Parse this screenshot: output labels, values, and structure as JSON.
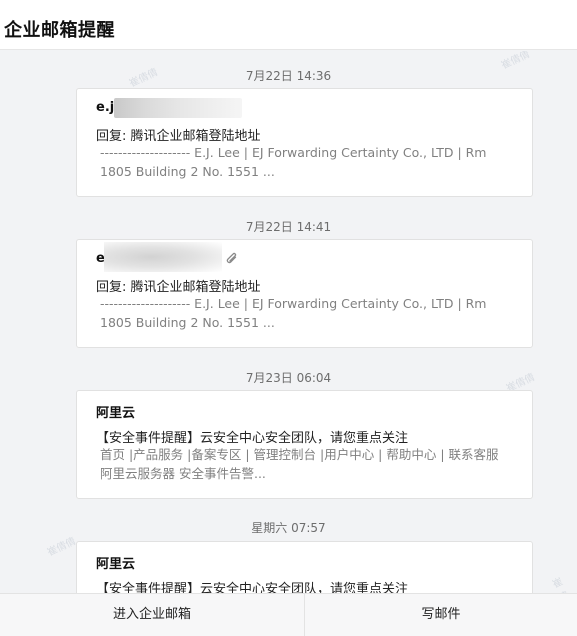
{
  "header": {
    "title": "企业邮箱提醒"
  },
  "messages": [
    {
      "time": "7月22日 14:36",
      "sender": "e.j.",
      "subject": "回复: 腾讯企业邮箱登陆地址",
      "preview_line1": "-------------------- E.J. Lee | EJ Forwarding Certainty Co., LTD | Rm",
      "preview_line2": "1805 Building 2 No. 1551 ...",
      "has_attachment": false
    },
    {
      "time": "7月22日 14:41",
      "sender": "e",
      "subject": "回复: 腾讯企业邮箱登陆地址",
      "preview_line1": "-------------------- E.J. Lee | EJ Forwarding Certainty Co., LTD | Rm",
      "preview_line2": "1805 Building 2 No. 1551 ...",
      "has_attachment": true
    },
    {
      "time": "7月23日 06:04",
      "sender": "阿里云",
      "subject": "【安全事件提醒】云安全中心安全团队，请您重点关注",
      "preview_line1": "首页 |产品服务 |备案专区 | 管理控制台 |用户中心 | 帮助中心 | 联系客服",
      "preview_line2": "阿里云服务器 安全事件告警...",
      "has_attachment": false
    },
    {
      "time": "星期六 07:57",
      "sender": "阿里云",
      "subject": "【安全事件提醒】云安全中心安全团队，请您重点关注",
      "preview_line1": "",
      "preview_line2": "",
      "has_attachment": false
    }
  ],
  "watermark_text": "崔倩倩",
  "footer": {
    "enter_mailbox_label": "进入企业邮箱",
    "compose_label": "写邮件"
  },
  "icons": {
    "attachment": "paperclip-icon"
  }
}
